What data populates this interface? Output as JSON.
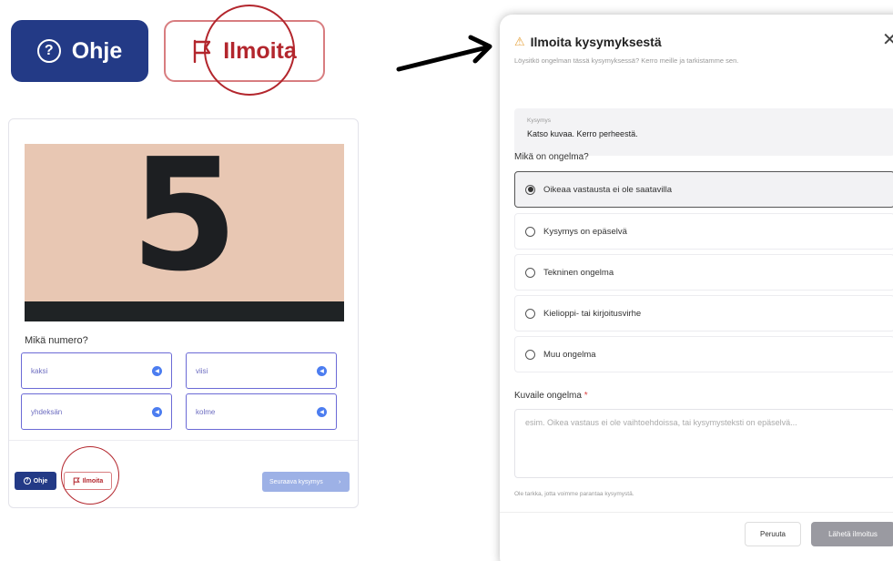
{
  "zoom_buttons": {
    "help": {
      "icon": "?",
      "label": "Ohje"
    },
    "report": {
      "label": "Ilmoita"
    }
  },
  "quiz": {
    "image_digit": "5",
    "question": "Mikä numero?",
    "answers": [
      {
        "label": "kaksi"
      },
      {
        "label": "viisi"
      },
      {
        "label": "yhdeksän"
      },
      {
        "label": "kolme"
      }
    ],
    "help_label": "Ohje",
    "report_label": "Ilmoita",
    "next_label": "Seuraava kysymys",
    "next_chevron": "›"
  },
  "modal": {
    "title": "Ilmoita kysymyksestä",
    "warn_icon": "⚠",
    "close_icon": "✕",
    "subtitle": "Löysitkö ongelman tässä kysymyksessä? Kerro meille ja tarkistamme sen.",
    "question_label": "Kysymys",
    "question_text": "Katso kuvaa. Kerro perheestä.",
    "problem_heading": "Mikä on ongelma?",
    "options": [
      {
        "label": "Oikeaa vastausta ei ole saatavilla",
        "selected": true
      },
      {
        "label": "Kysymys on epäselvä",
        "selected": false
      },
      {
        "label": "Tekninen ongelma",
        "selected": false
      },
      {
        "label": "Kielioppi- tai kirjoitusvirhe",
        "selected": false
      },
      {
        "label": "Muu ongelma",
        "selected": false
      }
    ],
    "describe_heading": "Kuvaile ongelma",
    "required_mark": "*",
    "describe_placeholder": "esim. Oikea vastaus ei ole vaihtoehdoissa, tai kysymysteksti on epäselvä...",
    "help_note": "Ole tarkka, jotta voimme parantaa kysymystä.",
    "cancel_label": "Peruuta",
    "submit_label": "Lähetä ilmoitus"
  },
  "colors": {
    "primary_navy": "#233a86",
    "report_red": "#b3262d",
    "answer_border": "#6b6ad6",
    "next_disabled": "#9db1e6",
    "submit_disabled": "#9a9aa1",
    "warning": "#e6a23c"
  }
}
